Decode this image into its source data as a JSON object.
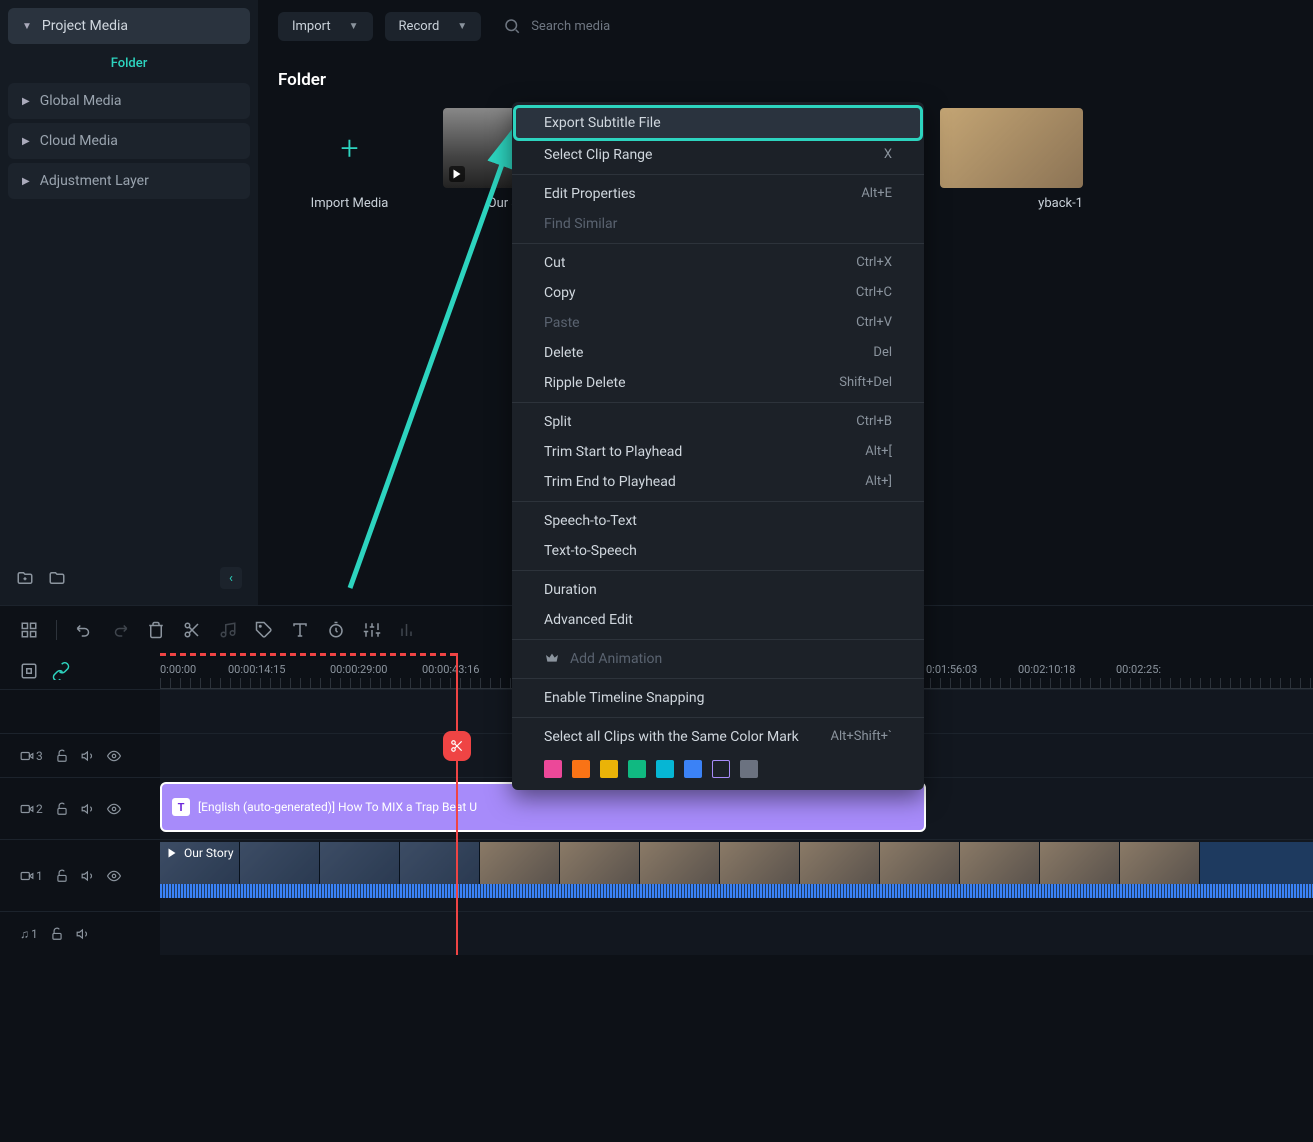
{
  "sidebar": {
    "projectMedia": "Project Media",
    "folder": "Folder",
    "globalMedia": "Global Media",
    "cloudMedia": "Cloud Media",
    "adjustmentLayer": "Adjustment Layer"
  },
  "toolbar": {
    "import": "Import",
    "record": "Record",
    "searchPlaceholder": "Search media"
  },
  "main": {
    "folderTitle": "Folder",
    "importMedia": "Import Media",
    "clips": [
      "Our Story",
      "yback-1"
    ]
  },
  "context": {
    "items": [
      {
        "label": "Export Subtitle File",
        "sc": "",
        "hl": true
      },
      {
        "label": "Select Clip Range",
        "sc": "X"
      },
      {
        "sep": true
      },
      {
        "label": "Edit Properties",
        "sc": "Alt+E"
      },
      {
        "label": "Find Similar",
        "sc": "",
        "dis": true
      },
      {
        "sep": true
      },
      {
        "label": "Cut",
        "sc": "Ctrl+X"
      },
      {
        "label": "Copy",
        "sc": "Ctrl+C"
      },
      {
        "label": "Paste",
        "sc": "Ctrl+V",
        "dis": true
      },
      {
        "label": "Delete",
        "sc": "Del"
      },
      {
        "label": "Ripple Delete",
        "sc": "Shift+Del"
      },
      {
        "sep": true
      },
      {
        "label": "Split",
        "sc": "Ctrl+B"
      },
      {
        "label": "Trim Start to Playhead",
        "sc": "Alt+["
      },
      {
        "label": "Trim End to Playhead",
        "sc": "Alt+]"
      },
      {
        "sep": true
      },
      {
        "label": "Speech-to-Text",
        "sc": ""
      },
      {
        "label": "Text-to-Speech",
        "sc": ""
      },
      {
        "sep": true
      },
      {
        "label": "Duration",
        "sc": ""
      },
      {
        "label": "Advanced Edit",
        "sc": ""
      },
      {
        "sep": true
      },
      {
        "label": "Add Animation",
        "sc": "",
        "dis": true,
        "crown": true
      },
      {
        "sep": true
      },
      {
        "label": "Enable Timeline Snapping",
        "sc": ""
      },
      {
        "sep": true
      },
      {
        "label": "Select all Clips with the Same Color Mark",
        "sc": "Alt+Shift+`"
      }
    ],
    "colors": [
      "#ec4899",
      "#f97316",
      "#eab308",
      "#10b981",
      "#06b6d4",
      "#3b82f6",
      "outline",
      "#6b7280"
    ]
  },
  "timeline": {
    "ticks": [
      "0:00:00",
      "00:00:14:15",
      "00:00:29:00",
      "00:00:43:16",
      "0:01:56:03",
      "00:02:10:18",
      "00:02:25:"
    ],
    "tracks": {
      "t3": "3",
      "t2": "2",
      "t1": "1",
      "a1": "1"
    },
    "subClip": "[English (auto-generated)] How To MIX a Trap Beat U",
    "mainClip": "Our Story"
  }
}
